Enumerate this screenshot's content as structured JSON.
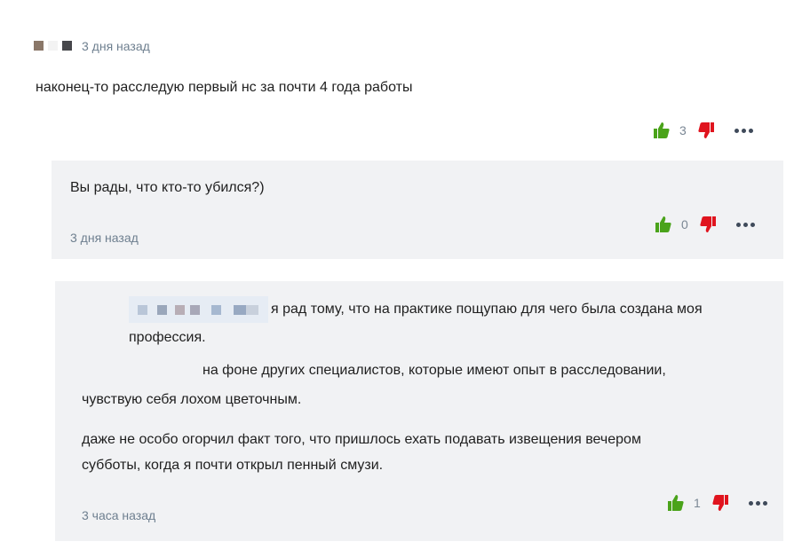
{
  "colors": {
    "like": "#4aa31a",
    "dislike": "#e0141e",
    "meta": "#6e7f8f",
    "reply_bg": "#f1f2f4"
  },
  "comment": {
    "time": "3 дня назад",
    "text": "наконец-то расследую первый нс за почти 4 года работы",
    "likes": "3"
  },
  "reply1": {
    "text": "Вы рады, что кто-то убился?)",
    "time": "3 дня назад",
    "likes": "0"
  },
  "reply2": {
    "line1": "я рад тому, что на практике пощупаю для чего была создана моя",
    "line2": "профессия.",
    "line3": "на фоне других специалистов, которые имеют опыт в расследовании,",
    "line4": "чувствую себя лохом цветочным.",
    "line5": "даже не особо огорчил факт того, что пришлось ехать подавать извещения вечером",
    "line6": "субботы, когда я почти открыл пенный смузи.",
    "time": "3 часа назад",
    "likes": "1"
  },
  "icons": [
    "thumbs-up-icon",
    "thumbs-down-icon",
    "more-options-icon"
  ]
}
